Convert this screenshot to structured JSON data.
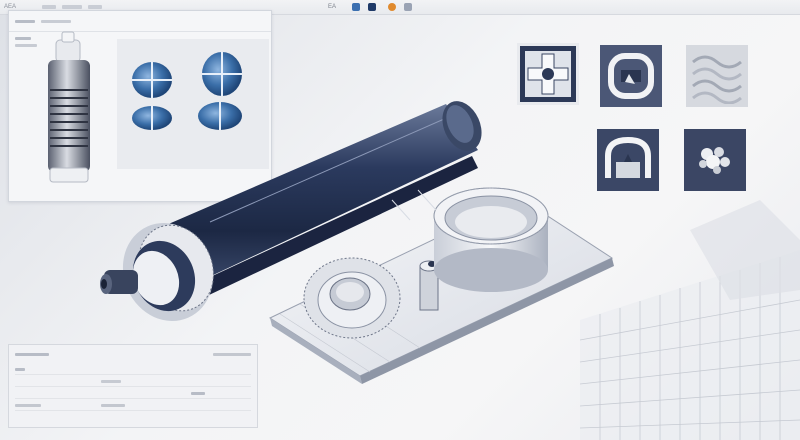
{
  "window": {
    "app_label": "AEA",
    "toolbar_text": "EA",
    "accent_colors": [
      "#1f3a68",
      "#3b6fb0",
      "#e08a2e",
      "#6a7fa6"
    ]
  },
  "left_panel": {
    "title": "",
    "thumbnails": [
      "threaded-cylinder-icon",
      "blue-cross-cap-icon",
      "blue-cross-cap-icon"
    ]
  },
  "bottom_panel": {
    "rows": [
      {
        "label": "",
        "value": "",
        "unit": ""
      },
      {
        "label": "",
        "value": "",
        "unit": ""
      },
      {
        "label": "",
        "value": "",
        "unit": ""
      },
      {
        "label": "",
        "value": "",
        "unit": ""
      }
    ]
  },
  "icons": [
    {
      "name": "cross-gear-icon",
      "style": "dark-framed"
    },
    {
      "name": "rounded-frame-icon",
      "style": "outlined"
    },
    {
      "name": "wavy-texture-icon",
      "style": "light"
    },
    {
      "name": "arch-frame-icon",
      "style": "outlined"
    },
    {
      "name": "crushed-particles-icon",
      "style": "dark"
    }
  ],
  "scene": {
    "objects": [
      "roller-shaft",
      "gear-disc",
      "tray-plate",
      "ring-cylinder",
      "shaft-pin",
      "grid-sheet"
    ]
  }
}
